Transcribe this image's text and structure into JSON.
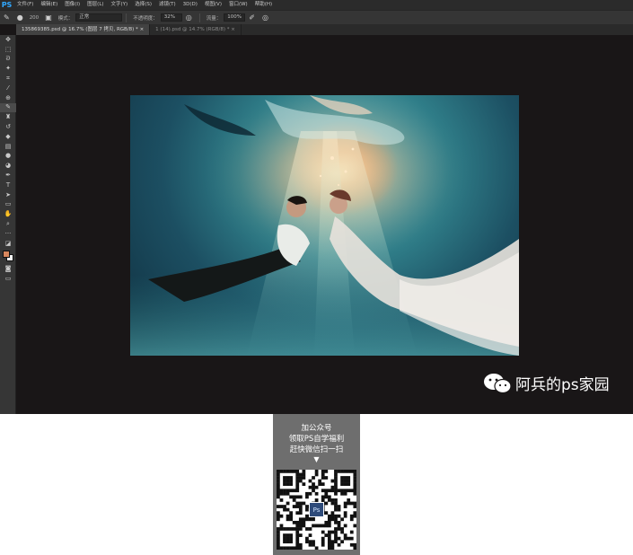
{
  "menubar": {
    "logo": "PS",
    "items": [
      "文件(F)",
      "编辑(E)",
      "图像(I)",
      "图层(L)",
      "文字(Y)",
      "选择(S)",
      "滤镜(T)",
      "3D(D)",
      "视图(V)",
      "窗口(W)",
      "帮助(H)"
    ]
  },
  "options": {
    "brush_size": "200",
    "mode_label": "模式：",
    "mode_value": "正常",
    "opacity_label": "不透明度：",
    "opacity_value": "32%",
    "flow_label": "流量：",
    "flow_value": "100%"
  },
  "tabs": [
    {
      "label": "135869385.psd @ 16.7% (图层 7 拷贝, RGB/8) *",
      "active": true
    },
    {
      "label": "1 (14).psd @ 14.7% (RGB/8) *",
      "active": false
    }
  ],
  "watermark": {
    "text": "阿兵的ps家园"
  },
  "promo": {
    "line1": "加公众号",
    "line2": "领取PS自学福利",
    "line3": "赶快微信扫一扫",
    "arrow": "▼",
    "qr_center_label": "Ps"
  },
  "colors": {
    "foreground": "#d8875e",
    "background": "#f3f3f3",
    "ps_blue": "#31a8ff"
  }
}
